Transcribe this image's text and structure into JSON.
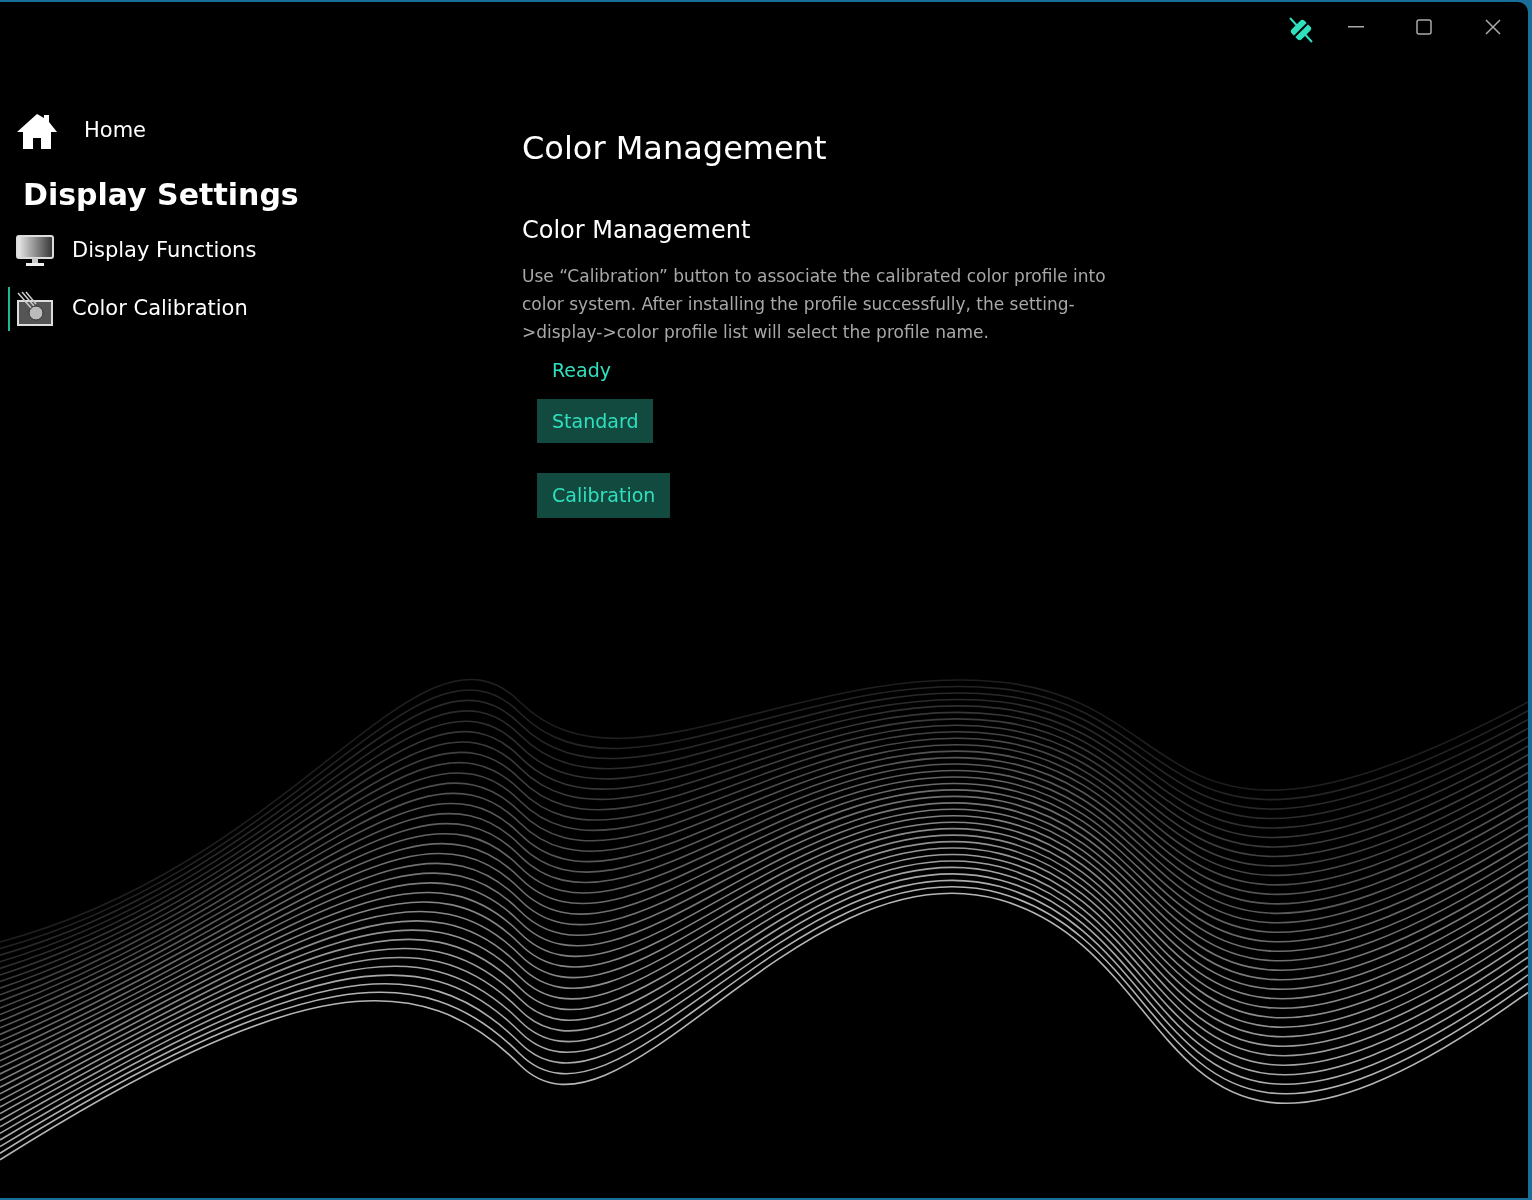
{
  "sidebar": {
    "home": {
      "label": "Home"
    },
    "heading": "Display Settings",
    "items": [
      {
        "label": "Display Functions",
        "kind": "monitor",
        "selected": false
      },
      {
        "label": "Color Calibration",
        "kind": "calibration",
        "selected": true
      }
    ]
  },
  "page": {
    "title": "Color Management",
    "section": "Color Management",
    "description": "Use “Calibration” button to associate the calibrated color profile into color system. After installing the profile successfully, the setting->display->color profile list will select the profile name.",
    "status": "Ready",
    "buttons": [
      "Standard",
      "Calibration"
    ]
  }
}
